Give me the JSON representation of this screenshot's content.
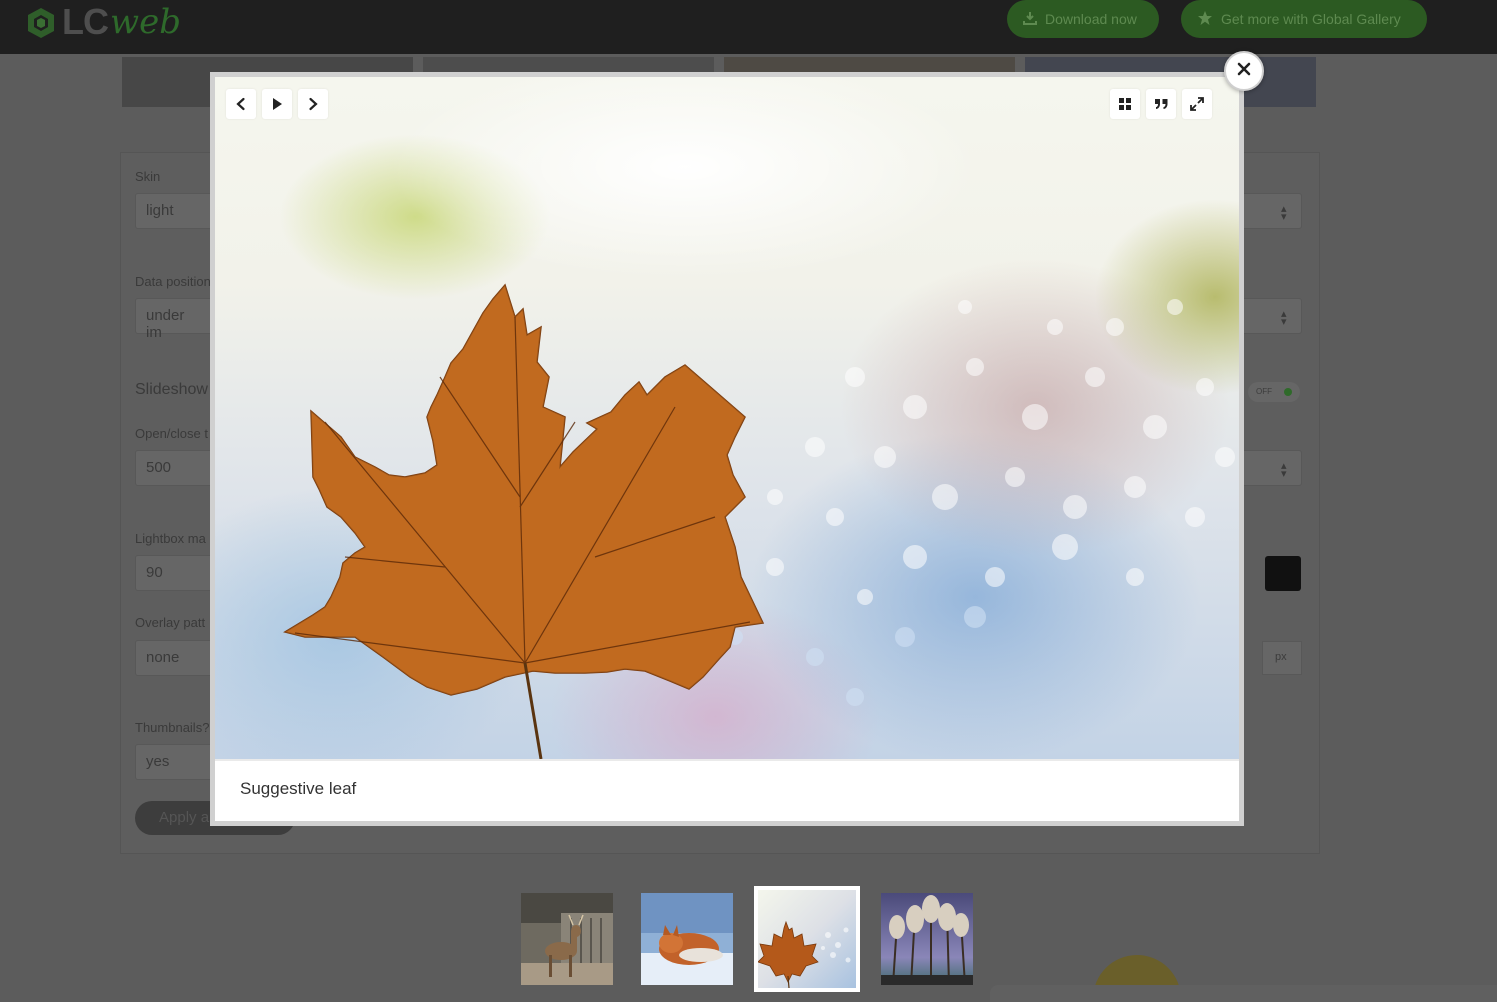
{
  "header": {
    "logo_lc": "LC",
    "logo_web": "web",
    "download_label": "Download now",
    "more_label": "Get more with Global Gallery"
  },
  "settings": {
    "skin_label": "Skin",
    "skin_value": "light",
    "data_position_label": "Data position",
    "data_position_value": "under im",
    "slideshow_title": "Slideshow",
    "open_close_label": "Open/close t",
    "open_close_value": "500",
    "lightbox_max_label": "Lightbox ma",
    "lightbox_max_value": "90",
    "overlay_pattern_label": "Overlay patt",
    "overlay_pattern_value": "none",
    "thumbnails_label": "Thumbnails?",
    "thumbnails_value": "yes",
    "toggle_text": "OFF",
    "px_unit": "px",
    "apply_label": "Apply a"
  },
  "lightbox": {
    "caption": "Suggestive leaf",
    "active_index": 2,
    "icons": {
      "prev": "chevron-left-icon",
      "play": "play-icon",
      "next": "chevron-right-icon",
      "thumbs": "grid-icon",
      "info": "quote-icon",
      "fullscreen": "expand-icon",
      "close": "close-icon"
    }
  },
  "thumbnails": [
    {
      "subject": "deer"
    },
    {
      "subject": "fox"
    },
    {
      "subject": "leaf"
    },
    {
      "subject": "trees"
    }
  ],
  "colors": {
    "accent_green": "#3c8f2e",
    "overlay": "#5c5c5c"
  }
}
